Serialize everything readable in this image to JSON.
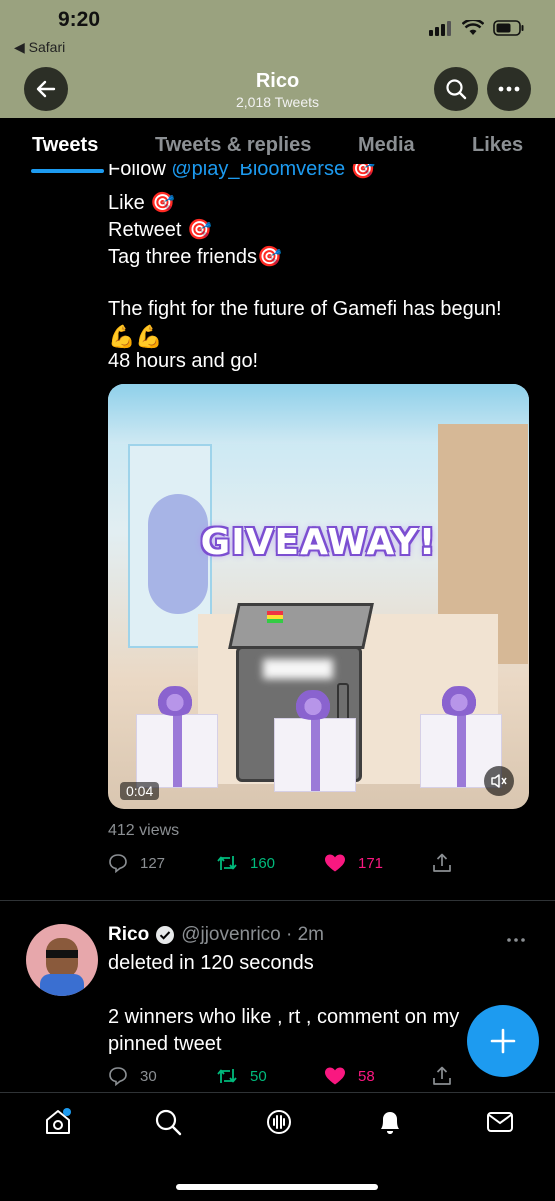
{
  "status_bar": {
    "time": "9:20",
    "back_app": "◀ Safari"
  },
  "header": {
    "title": "Rico",
    "subtitle": "2,018 Tweets"
  },
  "tabs": [
    {
      "label": "Tweets",
      "active": true
    },
    {
      "label": "Tweets & replies",
      "active": false
    },
    {
      "label": "Media",
      "active": false
    },
    {
      "label": "Likes",
      "active": false
    }
  ],
  "tweet1": {
    "partial_line_prefix": "Follow ",
    "partial_line_link": "@play_Bloomverse",
    "line_like": "Like",
    "line_retweet": "Retweet",
    "line_tag": "Tag three friends",
    "line_fight": "The fight for the future of Gamefi has begun!",
    "line_hours": "48 hours and go!",
    "media": {
      "overlay_text": "GIVEAWAY!",
      "duration": "0:04"
    },
    "views": "412 views",
    "replies": "127",
    "retweets": "160",
    "likes": "171"
  },
  "tweet2": {
    "name": "Rico",
    "handle_time": "@jjovenrico · 2m",
    "line1": "deleted in 120 seconds",
    "line2": "2 winners who like , rt , comment on my",
    "line3": "pinned tweet",
    "replies": "30",
    "retweets": "50",
    "likes": "58"
  },
  "colors": {
    "accent": "#1d9bf0",
    "retweet": "#00ba7c",
    "like": "#f91880",
    "header_bg": "#9aa27f"
  },
  "icons": [
    "back-arrow-icon",
    "search-icon",
    "more-icon",
    "reply-icon",
    "retweet-icon",
    "heart-icon",
    "share-icon",
    "verified-icon",
    "home-icon",
    "explore-icon",
    "spaces-icon",
    "notifications-icon",
    "messages-icon",
    "compose-icon",
    "mute-icon"
  ]
}
